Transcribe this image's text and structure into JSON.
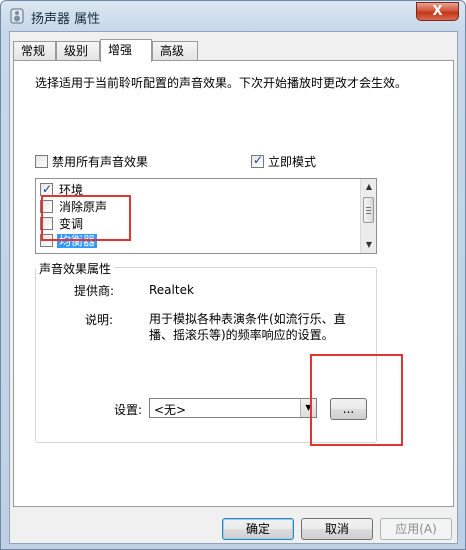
{
  "window": {
    "title": "扬声器 属性",
    "close_glyph": "X"
  },
  "tabs": [
    {
      "label": "常规",
      "active": false
    },
    {
      "label": "级别",
      "active": false
    },
    {
      "label": "增强",
      "active": true
    },
    {
      "label": "高级",
      "active": false
    }
  ],
  "enhancement": {
    "description": "选择适用于当前聆听配置的声音效果。下次开始播放时更改才会生效。",
    "disable_all": {
      "label": "禁用所有声音效果",
      "checked": false
    },
    "immediate_mode": {
      "label": "立即模式",
      "checked": true
    },
    "effects": [
      {
        "label": "环境",
        "checked": true,
        "selected": false
      },
      {
        "label": "消除原声",
        "checked": false,
        "selected": false
      },
      {
        "label": "变调",
        "checked": false,
        "selected": false
      },
      {
        "label": "均衡器",
        "checked": false,
        "selected": true
      }
    ],
    "properties": {
      "group_title": "声音效果属性",
      "provider_label": "提供商:",
      "provider_value": "Realtek",
      "description_label": "说明:",
      "description_value": "用于模拟各种表演条件(如流行乐、直播、摇滚乐等)的频率响应的设置。",
      "settings_label": "设置:",
      "settings_value": "<无>",
      "more_button": "..."
    }
  },
  "buttons": {
    "ok": "确定",
    "cancel": "取消",
    "apply": "应用(A)"
  },
  "icons": {
    "app": "speaker-icon",
    "dropdown": "chevron-down-icon",
    "scroll_up": "arrow-up-icon",
    "scroll_down": "arrow-down-icon"
  },
  "colors": {
    "selection": "#3399ff",
    "annotation": "#e03535",
    "default_button_border": "#3c7fb1"
  }
}
